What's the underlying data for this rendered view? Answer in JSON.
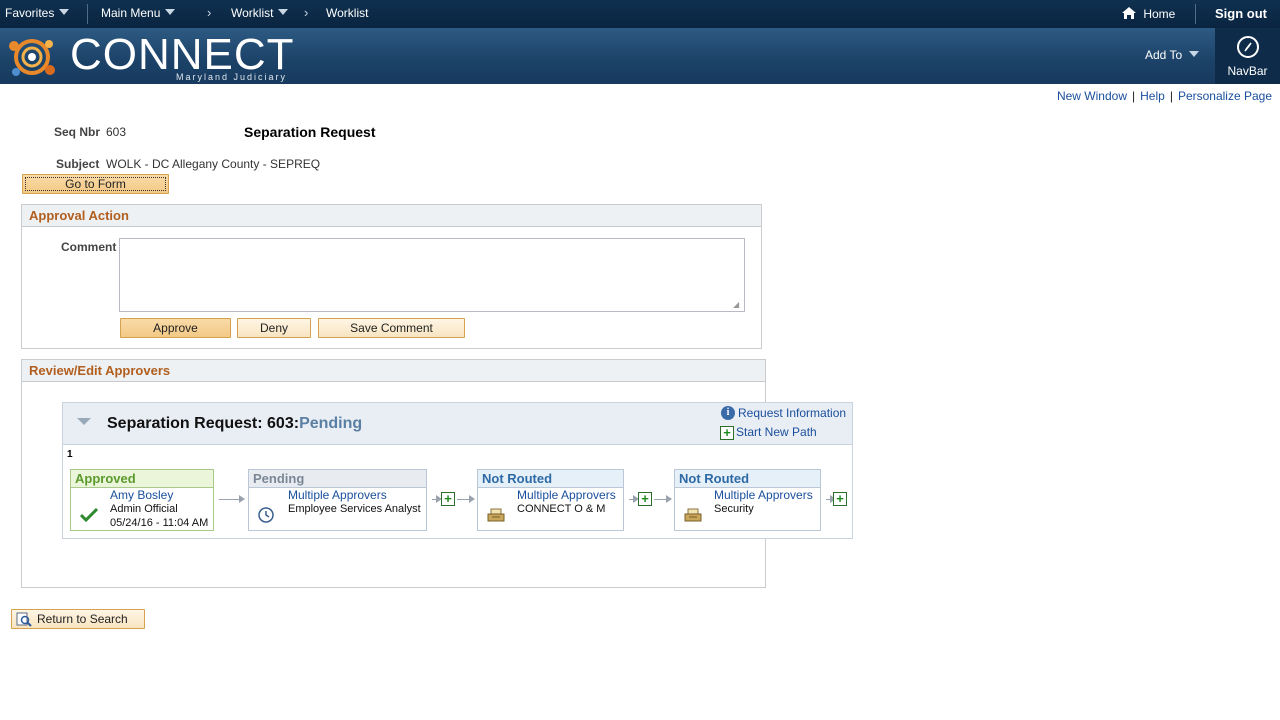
{
  "topnav": {
    "favorites": "Favorites",
    "main_menu": "Main Menu",
    "breadcrumb": [
      "Worklist",
      "Worklist"
    ],
    "home": "Home",
    "sign_out": "Sign out"
  },
  "banner": {
    "logo_title": "CONNECT",
    "logo_subtitle": "Maryland Judiciary",
    "add_to": "Add To",
    "navbar": "NavBar"
  },
  "page_links": [
    "New Window",
    "Help",
    "Personalize Page"
  ],
  "form": {
    "seq_label": "Seq Nbr",
    "seq_value": "603",
    "title": "Separation Request",
    "subject_label": "Subject",
    "subject_value": "WOLK - DC Allegany County - SEPREQ",
    "go_to_form": "Go to Form"
  },
  "approval_action": {
    "header": "Approval Action",
    "comment_label": "Comment",
    "comment_value": "",
    "buttons": {
      "approve": "Approve",
      "deny": "Deny",
      "save_comment": "Save Comment"
    }
  },
  "review": {
    "header": "Review/Edit Approvers",
    "path_title": "Separation Request: 603:",
    "path_status": "Pending",
    "request_information": "Request Information",
    "start_new_path": "Start New Path",
    "path_number": "1",
    "steps": [
      {
        "status": "Approved",
        "name": "Amy Bosley",
        "role": "Admin Official",
        "date": "05/24/16 - 11:04 AM",
        "icon": "checkmark-icon"
      },
      {
        "status": "Pending",
        "name": "Multiple Approvers",
        "role": "Employee Services Analyst",
        "icon": "clock-icon"
      },
      {
        "status": "Not Routed",
        "name": "Multiple Approvers",
        "role": "CONNECT O & M",
        "icon": "inbox-tray-icon"
      },
      {
        "status": "Not Routed",
        "name": "Multiple Approvers",
        "role": "Security",
        "icon": "inbox-tray-icon"
      }
    ]
  },
  "return_to_search": "Return to Search",
  "colors": {
    "topbar": "#0a2440",
    "banner": "#1c4268",
    "section_header_text": "#b15e1e",
    "link": "#1a4f9c",
    "approved": "#5b9a2c",
    "button_fill": "#f7d9a6"
  }
}
